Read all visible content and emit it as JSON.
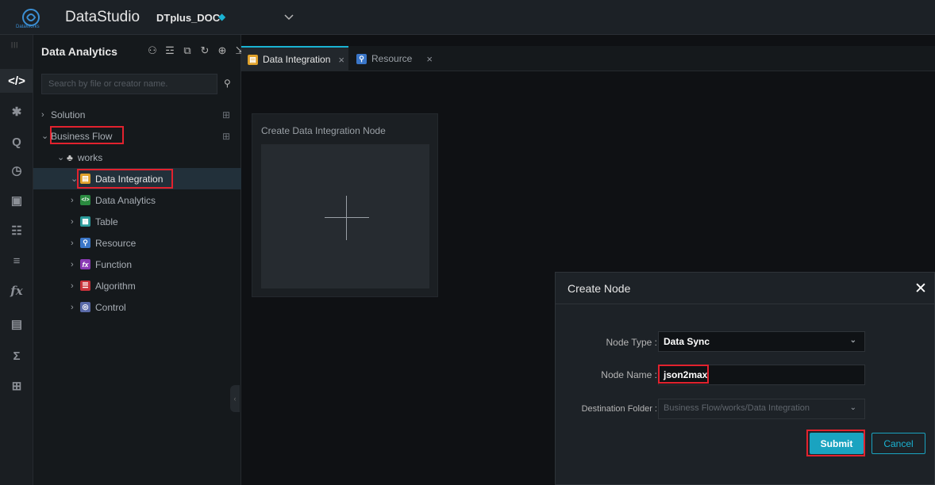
{
  "app": {
    "logo_sub": "DataWorks",
    "brand": "DataStudio",
    "project": "DTplus_DOC",
    "project_icon": "diamond-icon"
  },
  "iconbar": [
    {
      "icon": "code-icon",
      "glyph": "</>"
    },
    {
      "icon": "puzzle-icon",
      "glyph": "✱"
    },
    {
      "icon": "search-icon",
      "glyph": "Q"
    },
    {
      "icon": "clock-icon",
      "glyph": "◷"
    },
    {
      "icon": "save-icon",
      "glyph": "▣"
    },
    {
      "icon": "table-icon",
      "glyph": "☷"
    },
    {
      "icon": "list-icon",
      "glyph": "≡"
    },
    {
      "icon": "function-icon",
      "glyph": "fx"
    },
    {
      "icon": "stack-icon",
      "glyph": "▤"
    },
    {
      "icon": "sigma-icon",
      "glyph": "Σ"
    },
    {
      "icon": "trash-icon",
      "glyph": "🗑"
    }
  ],
  "sidepanel": {
    "title": "Data Analytics",
    "search_placeholder": "Search by file or creator name.",
    "tree": {
      "solution": "Solution",
      "business_flow": "Business Flow",
      "works": "works",
      "items": [
        {
          "label": "Data Integration",
          "color": "#e0a12a",
          "glyph": "▤"
        },
        {
          "label": "Data Analytics",
          "color": "#2a8a3f",
          "glyph": "<>"
        },
        {
          "label": "Table",
          "color": "#2a9a9a",
          "glyph": "▦"
        },
        {
          "label": "Resource",
          "color": "#3a76c8",
          "glyph": "⚲"
        },
        {
          "label": "Function",
          "color": "#8a3ab4",
          "glyph": "fx"
        },
        {
          "label": "Algorithm",
          "color": "#c8323a",
          "glyph": "☰"
        },
        {
          "label": "Control",
          "color": "#5a6aa8",
          "glyph": "◎"
        }
      ]
    }
  },
  "tabs": [
    {
      "label": "Data Integration",
      "close": "×"
    },
    {
      "label": "Resource",
      "close": "×"
    }
  ],
  "card": {
    "title": "Create Data Integration Node"
  },
  "modal": {
    "title": "Create Node",
    "close": "✕",
    "node_type_label": "Node Type :",
    "node_type_value": "Data Sync",
    "node_name_label": "Node Name :",
    "node_name_value": "json2max",
    "folder_label": "Destination Folder :",
    "folder_value": "Business Flow/works/Data Integration",
    "submit": "Submit",
    "cancel": "Cancel"
  },
  "colors": {
    "accent": "#1ab3d3",
    "highlight": "#e2222e"
  }
}
